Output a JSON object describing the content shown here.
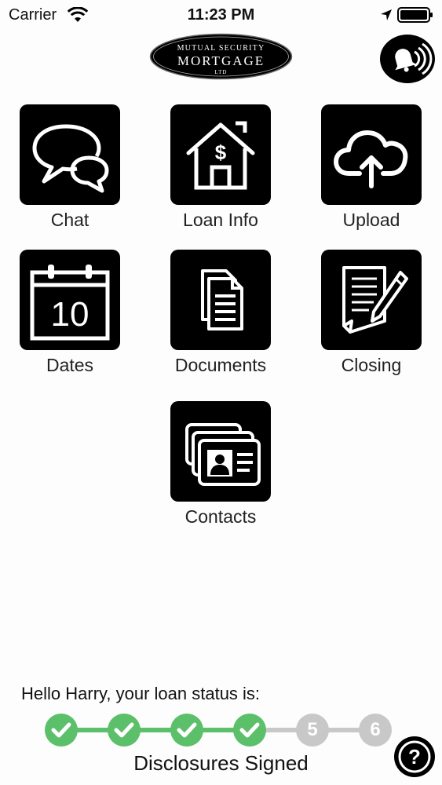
{
  "status_bar": {
    "carrier": "Carrier",
    "time": "11:23 PM"
  },
  "header": {
    "logo_text_top": "MUTUAL SECURITY",
    "logo_text_main": "MORTGAGE",
    "logo_text_sub": "LTD",
    "sound_icon": "bell-sound-icon"
  },
  "tiles": [
    {
      "label": "Chat",
      "icon": "chat-bubbles-icon"
    },
    {
      "label": "Loan Info",
      "icon": "house-dollar-icon"
    },
    {
      "label": "Upload",
      "icon": "cloud-upload-icon"
    },
    {
      "label": "Dates",
      "icon": "calendar-icon",
      "calendar_number": "10"
    },
    {
      "label": "Documents",
      "icon": "documents-icon"
    },
    {
      "label": "Closing",
      "icon": "document-pen-icon"
    },
    {
      "label": "Contacts",
      "icon": "contact-cards-icon"
    }
  ],
  "loan_status": {
    "greeting": "Hello Harry, your loan status is:",
    "steps_completed": 4,
    "pending_steps": [
      "5",
      "6"
    ],
    "current_label": "Disclosures Signed"
  },
  "colors": {
    "complete": "#5cbf6a",
    "pending": "#c8c8c8",
    "tile_bg": "#000000"
  },
  "help_icon": "question-mark-icon"
}
